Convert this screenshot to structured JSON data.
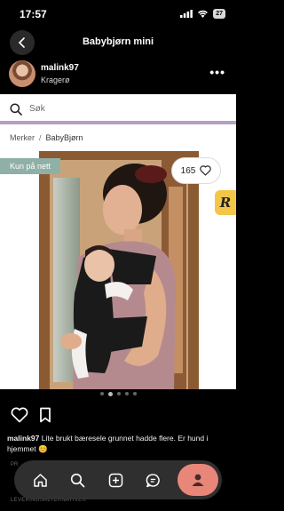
{
  "status": {
    "time": "17:57",
    "battery": "27"
  },
  "header": {
    "title": "Babybjørn mini"
  },
  "author": {
    "username": "malink97",
    "location": "Kragerø"
  },
  "screenshot": {
    "search_placeholder": "Søk",
    "breadcrumb": {
      "parent": "Merker",
      "separator": "/",
      "current": "BabyBjørn"
    },
    "badge": "Kun på nett",
    "likes": "165",
    "r_badge": "R"
  },
  "carousel": {
    "count": 5,
    "active": 2
  },
  "caption": {
    "user": "malink97",
    "text": "Lite brukt bæresele grunnet hadde flere. Er hund i hjemmet 😊"
  },
  "peek": {
    "line1": "PR",
    "line2": "LEVERINGSALTERNATIVER"
  },
  "colors": {
    "accent": "#e9867a",
    "badge": "#8fb0a6",
    "divider": "#b59ec4",
    "r_badge": "#f3c64a"
  }
}
